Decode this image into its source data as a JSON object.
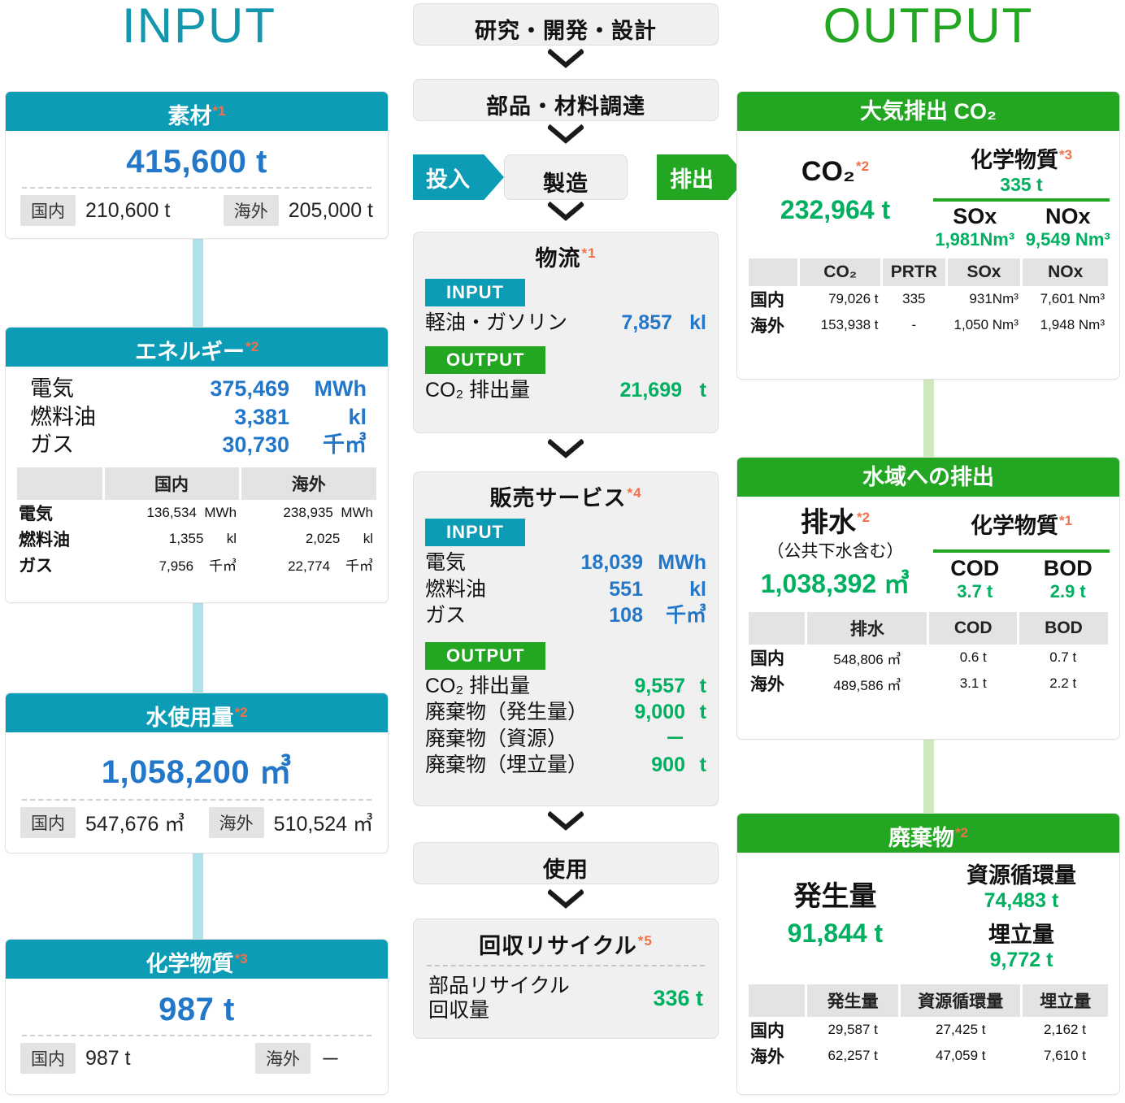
{
  "colors": {
    "input": "#0d9cb5",
    "output": "#23a723",
    "blue_value": "#2277c8",
    "green_value": "#00b060",
    "ref_orange": "#f0714a"
  },
  "titles": {
    "input": "INPUT",
    "output": "OUTPUT"
  },
  "input": {
    "materials": {
      "heading": "素材",
      "ref": "*1",
      "total": "415,600 t",
      "domestic_label": "国内",
      "domestic_value": "210,600 t",
      "overseas_label": "海外",
      "overseas_value": "205,000 t"
    },
    "energy": {
      "heading": "エネルギー",
      "ref": "*2",
      "rows": [
        {
          "label": "電気",
          "value": "375,469",
          "unit": "MWh"
        },
        {
          "label": "燃料油",
          "value": "3,381",
          "unit": "kl"
        },
        {
          "label": "ガス",
          "value": "30,730",
          "unit": "千㎥"
        }
      ],
      "table": {
        "columns": [
          "",
          "国内",
          "海外"
        ],
        "rows": [
          {
            "label": "電気",
            "domestic": "136,534",
            "domestic_unit": "MWh",
            "overseas": "238,935",
            "overseas_unit": "MWh"
          },
          {
            "label": "燃料油",
            "domestic": "1,355",
            "domestic_unit": "kl",
            "overseas": "2,025",
            "overseas_unit": "kl"
          },
          {
            "label": "ガス",
            "domestic": "7,956",
            "domestic_unit": "千㎥",
            "overseas": "22,774",
            "overseas_unit": "千㎥"
          }
        ]
      }
    },
    "water": {
      "heading": "水使用量",
      "ref": "*2",
      "total": "1,058,200 ㎥",
      "domestic_label": "国内",
      "domestic_value": "547,676 ㎥",
      "overseas_label": "海外",
      "overseas_value": "510,524 ㎥"
    },
    "chemicals": {
      "heading": "化学物質",
      "ref": "*3",
      "total": "987 t",
      "domestic_label": "国内",
      "domestic_value": "987 t",
      "overseas_label": "海外",
      "overseas_value": "－"
    }
  },
  "flow": {
    "step_rd": "研究・開発・設計",
    "step_procure": "部品・材料調達",
    "step_manufacture": "製造",
    "banner_input": "投入",
    "banner_output": "排出",
    "logistics": {
      "title": "物流",
      "ref": "*1",
      "input_tag": "INPUT",
      "output_tag": "OUTPUT",
      "input_rows": [
        {
          "label": "軽油・ガソリン",
          "value": "7,857",
          "unit": "kl"
        }
      ],
      "output_rows": [
        {
          "label": "CO₂ 排出量",
          "value": "21,699",
          "unit": "t"
        }
      ]
    },
    "sales": {
      "title": "販売サービス",
      "ref": "*4",
      "input_tag": "INPUT",
      "output_tag": "OUTPUT",
      "input_rows": [
        {
          "label": "電気",
          "value": "18,039",
          "unit": "MWh"
        },
        {
          "label": "燃料油",
          "value": "551",
          "unit": "kl"
        },
        {
          "label": "ガス",
          "value": "108",
          "unit": "千㎥"
        }
      ],
      "output_rows": [
        {
          "label": "CO₂ 排出量",
          "value": "9,557",
          "unit": "t"
        },
        {
          "label": "廃棄物（発生量）",
          "value": "9,000",
          "unit": "t"
        },
        {
          "label": "廃棄物（資源）",
          "value": "－",
          "unit": ""
        },
        {
          "label": "廃棄物（埋立量）",
          "value": "900",
          "unit": "t"
        }
      ]
    },
    "step_use": "使用",
    "recycle": {
      "title": "回収リサイクル",
      "ref": "*5",
      "label": "部品リサイクル\n回収量",
      "label_line1": "部品リサイクル",
      "label_line2": "回収量",
      "value": "336 t"
    }
  },
  "output": {
    "air": {
      "heading": "大気排出 CO₂",
      "main_label": "CO₂",
      "main_ref": "*2",
      "main_value": "232,964 t",
      "chem_label": "化学物質",
      "chem_ref": "*3",
      "chem_total": "335 t",
      "chem_cols": [
        {
          "name": "SOx",
          "value": "1,981Nm³"
        },
        {
          "name": "NOx",
          "value": "9,549 Nm³"
        }
      ],
      "table": {
        "columns": [
          "",
          "CO₂",
          "PRTR",
          "SOx",
          "NOx"
        ],
        "rows": [
          {
            "label": "国内",
            "co2": "79,026 t",
            "prtr": "335",
            "sox": "931Nm³",
            "nox": "7,601 Nm³"
          },
          {
            "label": "海外",
            "co2": "153,938 t",
            "prtr": "-",
            "sox": "1,050 Nm³",
            "nox": "1,948 Nm³"
          }
        ]
      }
    },
    "water": {
      "heading": "水域への排出",
      "main_label": "排水",
      "main_ref": "*2",
      "main_sub": "（公共下水含む）",
      "main_value": "1,038,392 ㎥",
      "chem_label": "化学物質",
      "chem_ref": "*1",
      "chem_cols": [
        {
          "name": "COD",
          "value": "3.7 t"
        },
        {
          "name": "BOD",
          "value": "2.9 t"
        }
      ],
      "table": {
        "columns": [
          "",
          "排水",
          "COD",
          "BOD"
        ],
        "rows": [
          {
            "label": "国内",
            "drain": "548,806 ㎥",
            "cod": "0.6 t",
            "bod": "0.7 t"
          },
          {
            "label": "海外",
            "drain": "489,586 ㎥",
            "cod": "3.1 t",
            "bod": "2.2 t"
          }
        ]
      }
    },
    "waste": {
      "heading": "廃棄物",
      "ref": "*2",
      "main_label": "発生量",
      "main_value": "91,844 t",
      "side": [
        {
          "label": "資源循環量",
          "value": "74,483 t"
        },
        {
          "label": "埋立量",
          "value": "9,772 t"
        }
      ],
      "table": {
        "columns": [
          "",
          "発生量",
          "資源循環量",
          "埋立量"
        ],
        "rows": [
          {
            "label": "国内",
            "gen": "29,587 t",
            "recycle": "27,425 t",
            "landfill": "2,162 t"
          },
          {
            "label": "海外",
            "gen": "62,257 t",
            "recycle": "47,059 t",
            "landfill": "7,610 t"
          }
        ]
      }
    }
  }
}
